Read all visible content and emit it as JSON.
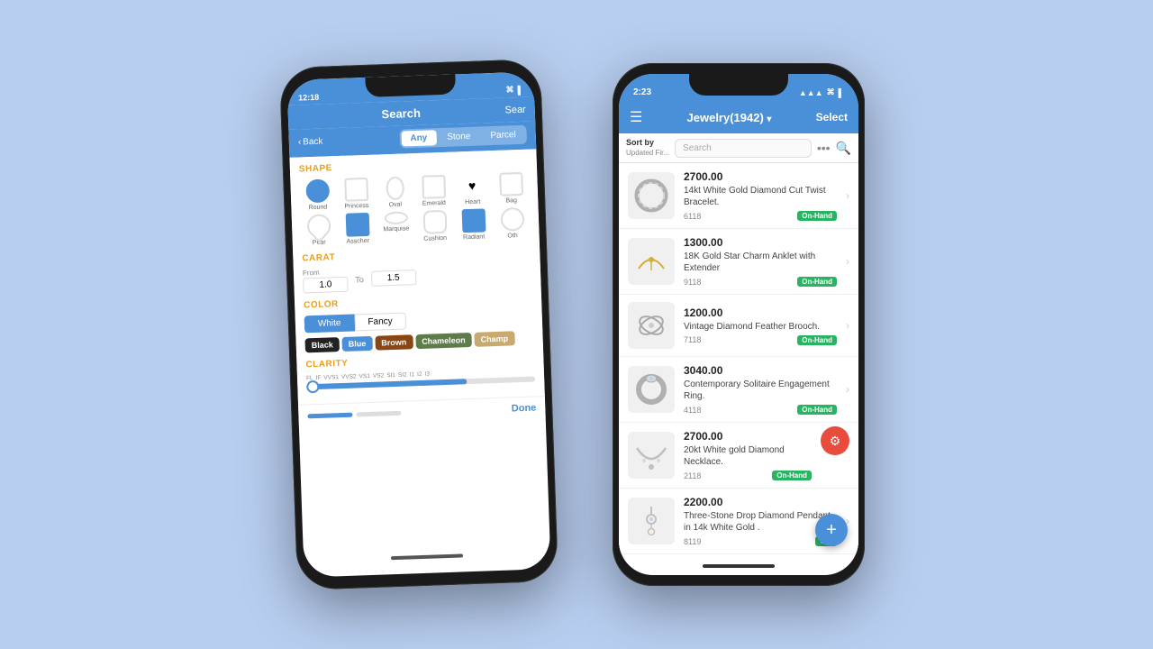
{
  "background": "#b8cef0",
  "phone_back": {
    "status_bar": {
      "time": "12:18",
      "right_label": "Sear"
    },
    "header": {
      "title": "Search",
      "search_label": "Sear"
    },
    "nav": {
      "back_label": "Back",
      "tabs": [
        {
          "label": "Any",
          "active": true
        },
        {
          "label": "Stone",
          "active": false
        },
        {
          "label": "Parcel",
          "active": false
        }
      ]
    },
    "shape_section": {
      "title": "SHAPE",
      "shapes": [
        {
          "label": "Round",
          "selected": true,
          "symbol": ""
        },
        {
          "label": "Princess",
          "selected": false,
          "symbol": ""
        },
        {
          "label": "Oval",
          "selected": false,
          "symbol": ""
        },
        {
          "label": "Emerald",
          "selected": false,
          "symbol": ""
        },
        {
          "label": "Heart",
          "selected": false,
          "symbol": "♥"
        },
        {
          "label": "Bag",
          "selected": false,
          "symbol": ""
        },
        {
          "label": "Pear",
          "selected": false,
          "symbol": ""
        },
        {
          "label": "Asscher",
          "selected": false,
          "symbol": ""
        },
        {
          "label": "Marquise",
          "selected": false,
          "symbol": ""
        },
        {
          "label": "Cushion",
          "selected": false,
          "symbol": ""
        },
        {
          "label": "Radiant",
          "selected": true,
          "symbol": ""
        },
        {
          "label": "Oth",
          "selected": false,
          "symbol": ""
        }
      ]
    },
    "carat_section": {
      "title": "CARAT",
      "from_label": "From",
      "to_label": "To",
      "from_value": "1.0",
      "to_value": "1.5"
    },
    "color_section": {
      "title": "COLOR",
      "toggle": [
        {
          "label": "White",
          "active": true
        },
        {
          "label": "Fancy",
          "active": false
        }
      ],
      "chips": [
        {
          "label": "Black",
          "color": "#222"
        },
        {
          "label": "Blue",
          "color": "#4a90d9"
        },
        {
          "label": "Brown",
          "color": "#8B4513"
        },
        {
          "label": "Chameleon",
          "color": "#5d7c4a"
        },
        {
          "label": "Champ",
          "color": "#C8A96E"
        }
      ]
    },
    "clarity_section": {
      "title": "CLARITY",
      "labels": [
        "FL",
        "IF",
        "VVS1",
        "VVS2",
        "VS1",
        "VS2",
        "SI1",
        "SI2",
        "I1",
        "I2",
        "I3"
      ],
      "fill_percent": 70
    },
    "done_bar": {
      "done_label": "Done"
    }
  },
  "phone_front": {
    "status_bar": {
      "time": "2:23"
    },
    "header": {
      "menu_icon": "☰",
      "title": "Jewelry(1942)",
      "title_arrow": "▾",
      "select_label": "Select"
    },
    "sort_bar": {
      "sort_label": "Sort by",
      "sort_sub": "Updated Fir...",
      "search_placeholder": "Search",
      "more_icon": "•••",
      "search_icon": "🔍"
    },
    "items": [
      {
        "price": "2700.00",
        "name": "14kt White Gold Diamond Cut Twist Bracelet.",
        "sku": "6118",
        "badge": "On-Hand",
        "thumb_type": "bracelet"
      },
      {
        "price": "1300.00",
        "name": "18K Gold Star Charm Anklet with Extender",
        "sku": "9118",
        "badge": "On-Hand",
        "thumb_type": "anklet"
      },
      {
        "price": "1200.00",
        "name": "Vintage Diamond Feather Brooch.",
        "sku": "7118",
        "badge": "On-Hand",
        "thumb_type": "brooch"
      },
      {
        "price": "3040.00",
        "name": "Contemporary Solitaire Engagement Ring.",
        "sku": "4118",
        "badge": "On-Hand",
        "thumb_type": "ring"
      },
      {
        "price": "2700.00",
        "name": "20kt White gold Diamond Necklace.",
        "sku": "2118",
        "badge": "On-Hand",
        "thumb_type": "necklace",
        "has_filter_fab": true
      },
      {
        "price": "2200.00",
        "name": "Three-Stone Drop Diamond Pendant in 14k White Gold .",
        "sku": "8119",
        "badge": "On-",
        "thumb_type": "pendant"
      }
    ],
    "fab_icon": "+"
  }
}
